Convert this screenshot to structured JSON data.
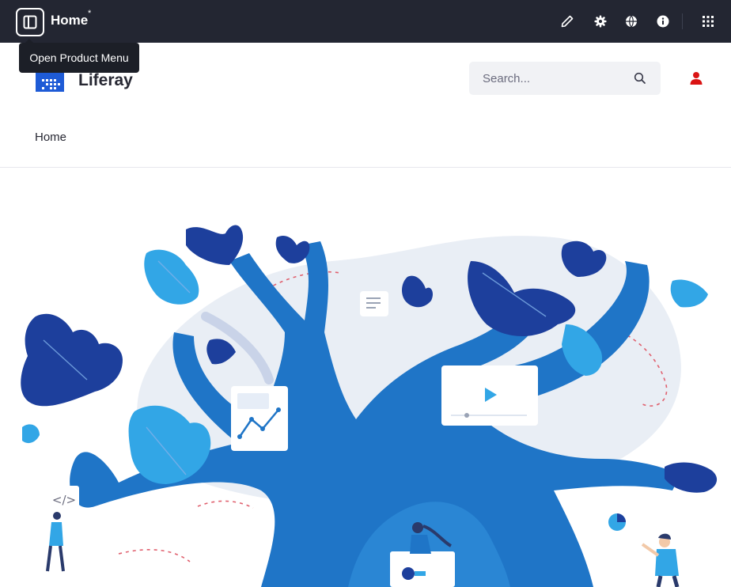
{
  "control_bar": {
    "page_title": "Home",
    "draft_marker": "*",
    "product_menu_tooltip": "Open Product Menu",
    "icons": [
      "product-menu-icon",
      "pencil-icon",
      "gear-icon",
      "simulation-icon",
      "info-icon",
      "apps-grid-icon"
    ]
  },
  "header": {
    "site_name": "Liferay",
    "search": {
      "placeholder": "Search...",
      "value": ""
    },
    "user_icon": "user-icon"
  },
  "navigation": {
    "items": [
      {
        "label": "Home"
      }
    ]
  },
  "hero": {
    "illustration": "tree-illustration",
    "code_tag": "</>"
  },
  "colors": {
    "control_bar_bg": "#232632",
    "tree_blue": "#1f75c7",
    "leaf_dark": "#1d3f9c",
    "leaf_light": "#32a6e6",
    "brand_blue": "#1e5bd6",
    "avatar_red": "#da1414"
  }
}
